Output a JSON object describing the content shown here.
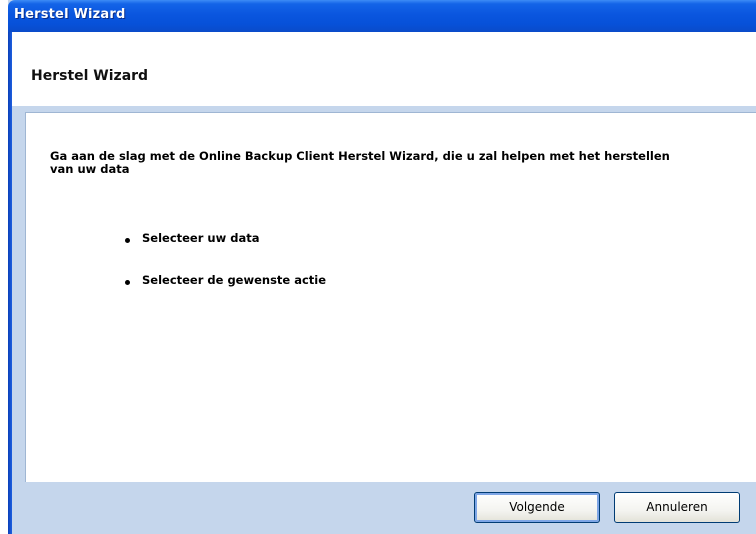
{
  "window": {
    "title": "Herstel Wizard"
  },
  "header": {
    "title": "Herstel Wizard"
  },
  "content": {
    "intro": "Ga aan de slag met de Online Backup Client Herstel Wizard, die u zal helpen met het herstellen van uw data",
    "steps": [
      "Selecteer uw data",
      "Selecteer de gewenste actie"
    ]
  },
  "footer": {
    "next_label": "Volgende",
    "cancel_label": "Annuleren"
  }
}
